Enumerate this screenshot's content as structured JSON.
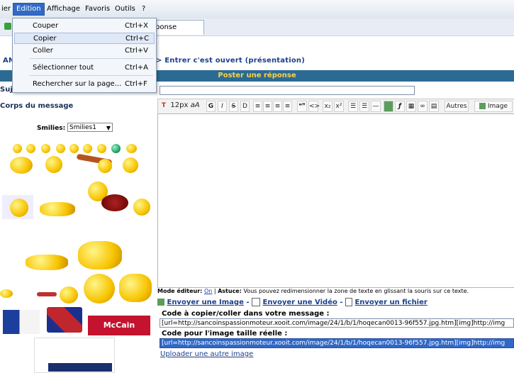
{
  "menubar": {
    "items": [
      "ier",
      "Edition",
      "Affichage",
      "Favoris",
      "Outils",
      "?"
    ]
  },
  "browser": {
    "tab_label": "ponse"
  },
  "edit_menu": {
    "items": [
      {
        "label": "Couper",
        "shortcut": "Ctrl+X"
      },
      {
        "label": "Copier",
        "shortcut": "Ctrl+C"
      },
      {
        "label": "Coller",
        "shortcut": "Ctrl+V"
      },
      {
        "label": "Sélectionner tout",
        "shortcut": "Ctrl+A"
      },
      {
        "label": "Rechercher sur la page...",
        "shortcut": "Ctrl+F"
      }
    ]
  },
  "page": {
    "breadcrumb_prefix": "AN",
    "breadcrumb": "> Entrer c'est ouvert (présentation)",
    "title": "Poster une réponse",
    "subject_label": "Sujet",
    "body_label": "Corps du message",
    "smilies_label": "Smilies:",
    "smilies_selected": "Smilies1"
  },
  "editor": {
    "font_size": "12px",
    "font_sample": "aA",
    "bold": "G",
    "italic": "I",
    "strike": "S",
    "underline": "D",
    "quote": "❝❞",
    "code": "<>",
    "subscript": "x₂",
    "superscript": "x²",
    "others_button": "Autres",
    "image_button": "Image"
  },
  "footer": {
    "mode_label": "Mode éditeur:",
    "mode_value": "On",
    "tip_label": "Astuce:",
    "tip_text": "Vous pouvez redimensionner la zone de texte en glissant la souris sur ce texte.",
    "send_image": "Envoyer une Image",
    "send_video": "Envoyer une Vidéo",
    "send_file": "Envoyer un fichier",
    "code_label_1": "Code à copier/coller dans votre message :",
    "code_value_1": "[url=http://sancoinspassionmoteur.xooit.com/image/24/1/b/1/hoqecan0013-96f557.jpg.htm][img]http://img",
    "code_label_2": "Code pour l'image taille réelle :",
    "code_value_2": "[url=http://sancoinspassionmoteur.xooit.com/image/24/1/b/1/hoqecan0013-96f557.jpg.htm][img]http://img",
    "upload_link": "Uploader une autre image"
  },
  "images": {
    "mccain_text": "McCain"
  },
  "colors": {
    "title_bar": "#2b6b93",
    "title_text": "#ffd24a",
    "link": "#1b3f8c",
    "selection": "#3168c5"
  }
}
